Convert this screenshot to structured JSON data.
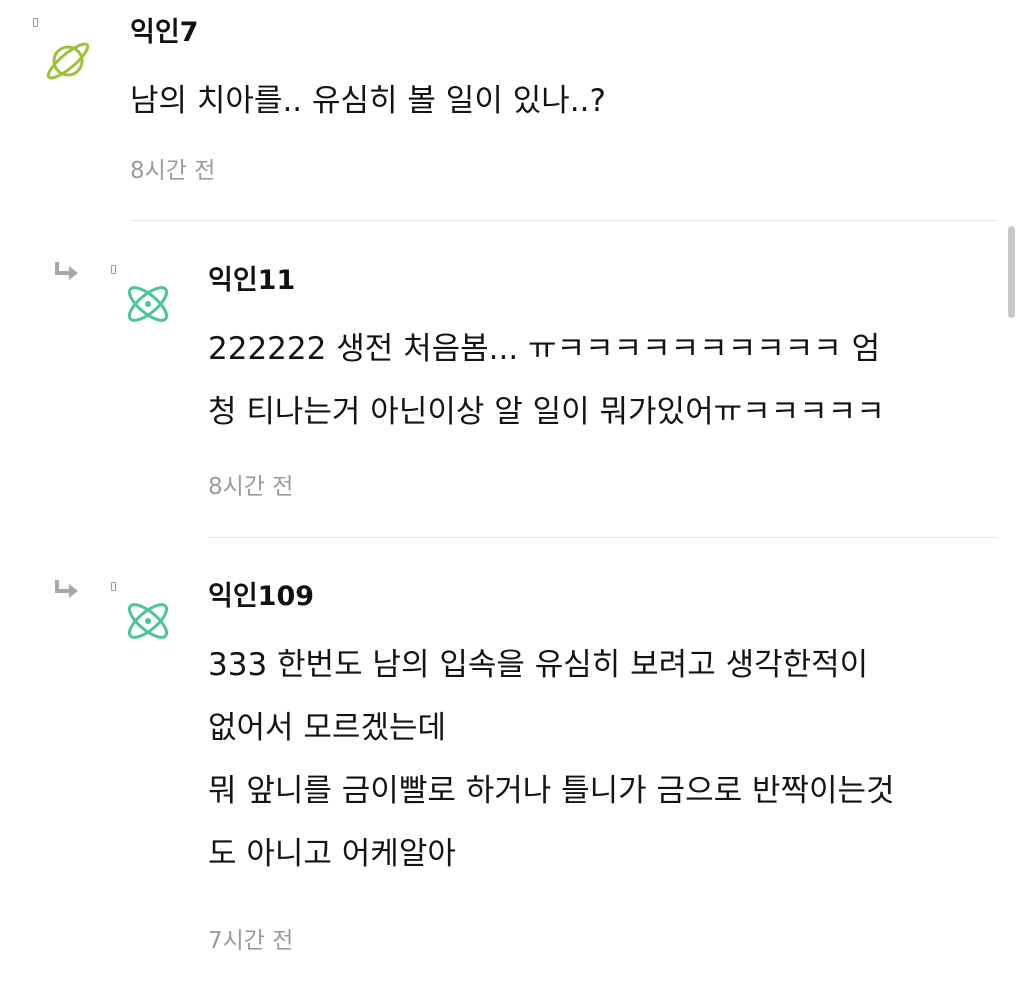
{
  "comments": [
    {
      "author": "익인7",
      "avatar_icon": "planet-icon",
      "avatar_color": "#9cc23a",
      "lines": [
        "남의 치아를.. 유심히 볼 일이 있나..?"
      ],
      "time": "8시간 전"
    },
    {
      "author": "익인11",
      "avatar_icon": "atom-icon",
      "avatar_color": "#4cc39a",
      "reply_icon": "reply-arrow-icon",
      "lines": [
        "222222 생전 처음봄... ㅠㅋㅋㅋㅋㅋㅋㅋㅋㅋㅋ 엄",
        "청 티나는거 아닌이상 알 일이 뭐가있어ㅠㅋㅋㅋㅋㅋ"
      ],
      "time": "8시간 전"
    },
    {
      "author": "익인109",
      "avatar_icon": "atom-icon",
      "avatar_color": "#4cc39a",
      "reply_icon": "reply-arrow-icon",
      "lines": [
        "333 한번도 남의 입속을 유심히 보려고 생각한적이",
        "없어서 모르겠는데",
        "뭐 앞니를 금이빨로 하거나 틀니가 금으로 반짝이는것",
        "도 아니고 어케알아"
      ],
      "time": "7시간 전"
    }
  ]
}
